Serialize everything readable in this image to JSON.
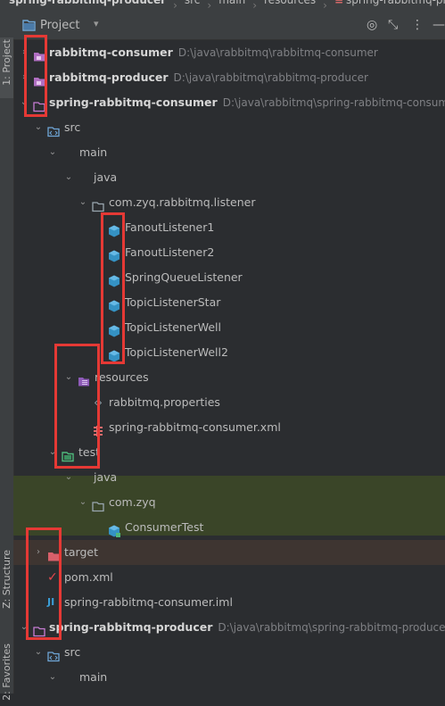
{
  "breadcrumb": {
    "items": [
      "spring-rabbitmq-producer",
      "src",
      "main",
      "resources",
      "spring-rabbitmq-produ"
    ]
  },
  "sidebar": {
    "project_tab": "1: Project",
    "structure_tab": "Z: Structure",
    "favorites_tab": "2: Favorites"
  },
  "panel": {
    "title": "Project",
    "buttons": [
      "target-icon",
      "collapse-icon",
      "more-icon",
      "hide-icon"
    ]
  },
  "tree": {
    "rows": [
      {
        "label": "rabbitmq-consumer",
        "bold": true,
        "path": "D:\\java\\rabbitmq\\rabbitmq-consumer",
        "icon": "module-folder-icon",
        "arrow": "right"
      },
      {
        "label": "rabbitmq-producer",
        "bold": true,
        "path": "D:\\java\\rabbitmq\\rabbitmq-producer",
        "icon": "module-folder-icon",
        "arrow": "right"
      },
      {
        "label": "spring-rabbitmq-consumer",
        "bold": true,
        "path": "D:\\java\\rabbitmq\\spring-rabbitmq-consumer",
        "icon": "module-folder-icon",
        "arrow": "down"
      },
      {
        "label": "src",
        "icon": "source-folder-icon",
        "arrow": "down"
      },
      {
        "label": "main",
        "icon": "",
        "arrow": "down"
      },
      {
        "label": "java",
        "icon": "",
        "arrow": "down"
      },
      {
        "label": "com.zyq.rabbitmq.listener",
        "icon": "package-icon",
        "arrow": "down"
      },
      {
        "label": "FanoutListener1",
        "icon": "class-icon"
      },
      {
        "label": "FanoutListener2",
        "icon": "class-icon"
      },
      {
        "label": "SpringQueueListener",
        "icon": "class-icon"
      },
      {
        "label": "TopicListenerStar",
        "icon": "class-icon"
      },
      {
        "label": "TopicListenerWell",
        "icon": "class-icon"
      },
      {
        "label": "TopicListenerWell2",
        "icon": "class-icon"
      },
      {
        "label": "resources",
        "icon": "resources-folder-icon",
        "arrow": "down"
      },
      {
        "label": "rabbitmq.properties",
        "icon": "properties-icon"
      },
      {
        "label": "spring-rabbitmq-consumer.xml",
        "icon": "xml-icon"
      },
      {
        "label": "test",
        "icon": "test-folder-icon",
        "arrow": "down"
      },
      {
        "label": "java",
        "icon": "",
        "arrow": "down"
      },
      {
        "label": "com.zyq",
        "icon": "package-icon",
        "arrow": "down"
      },
      {
        "label": "ConsumerTest",
        "icon": "test-class-icon"
      },
      {
        "label": "target",
        "icon": "excluded-folder-icon",
        "arrow": "right"
      },
      {
        "label": "pom.xml",
        "icon": "maven-icon"
      },
      {
        "label": "spring-rabbitmq-consumer.iml",
        "icon": "iml-icon"
      },
      {
        "label": "spring-rabbitmq-producer",
        "bold": true,
        "path": "D:\\java\\rabbitmq\\spring-rabbitmq-producer",
        "icon": "module-folder-icon",
        "arrow": "down"
      },
      {
        "label": "src",
        "icon": "source-folder-icon",
        "arrow": "down"
      },
      {
        "label": "main",
        "icon": "",
        "arrow": "down"
      }
    ]
  },
  "colors": {
    "annotation": "#e53935",
    "class_icon": "#3592c4",
    "module_icon": "#c77dd3",
    "highlight_green": "#3a4528",
    "highlight_brown": "#3e3531"
  }
}
